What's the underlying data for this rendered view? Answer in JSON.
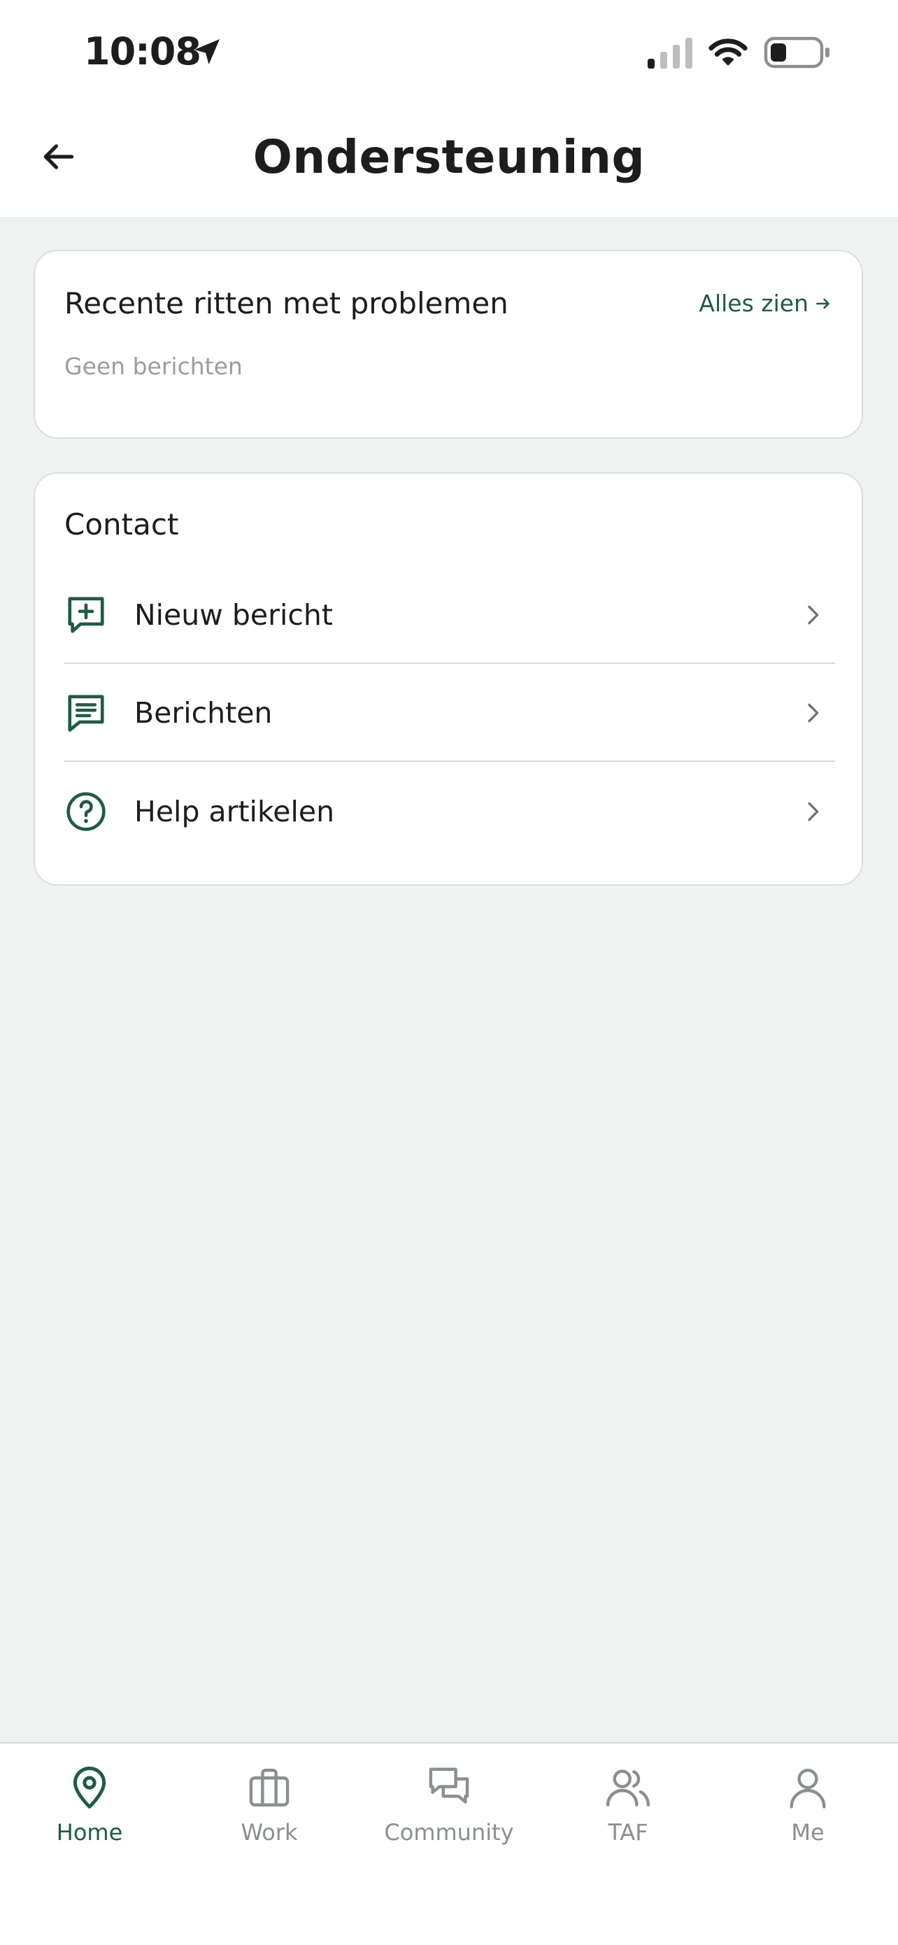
{
  "status_bar": {
    "time": "10:08",
    "icons": [
      "location-arrow-icon",
      "signal-icon",
      "wifi-icon",
      "battery-icon"
    ]
  },
  "header": {
    "title": "Ondersteuning",
    "back_icon": "arrow-left-icon"
  },
  "recent_issues": {
    "title": "Recente ritten met problemen",
    "see_all_label": "Alles zien",
    "see_all_icon": "arrow-right-icon",
    "empty_text": "Geen berichten"
  },
  "contact": {
    "title": "Contact",
    "items": [
      {
        "label": "Nieuw bericht",
        "icon": "message-plus-icon"
      },
      {
        "label": "Berichten",
        "icon": "message-lines-icon"
      },
      {
        "label": "Help artikelen",
        "icon": "question-circle-icon"
      }
    ]
  },
  "tab_bar": {
    "tabs": [
      {
        "label": "Home",
        "icon": "map-pin-icon",
        "active": true
      },
      {
        "label": "Work",
        "icon": "briefcase-icon",
        "active": false
      },
      {
        "label": "Community",
        "icon": "chat-bubbles-icon",
        "active": false
      },
      {
        "label": "TAF",
        "icon": "users-icon",
        "active": false
      },
      {
        "label": "Me",
        "icon": "user-icon",
        "active": false
      }
    ]
  },
  "colors": {
    "accent": "#1e5b45",
    "background": "#f0f1f1",
    "card": "#ffffff",
    "muted_text": "#9a9d9c",
    "inactive_tab": "#8b8f8d"
  }
}
